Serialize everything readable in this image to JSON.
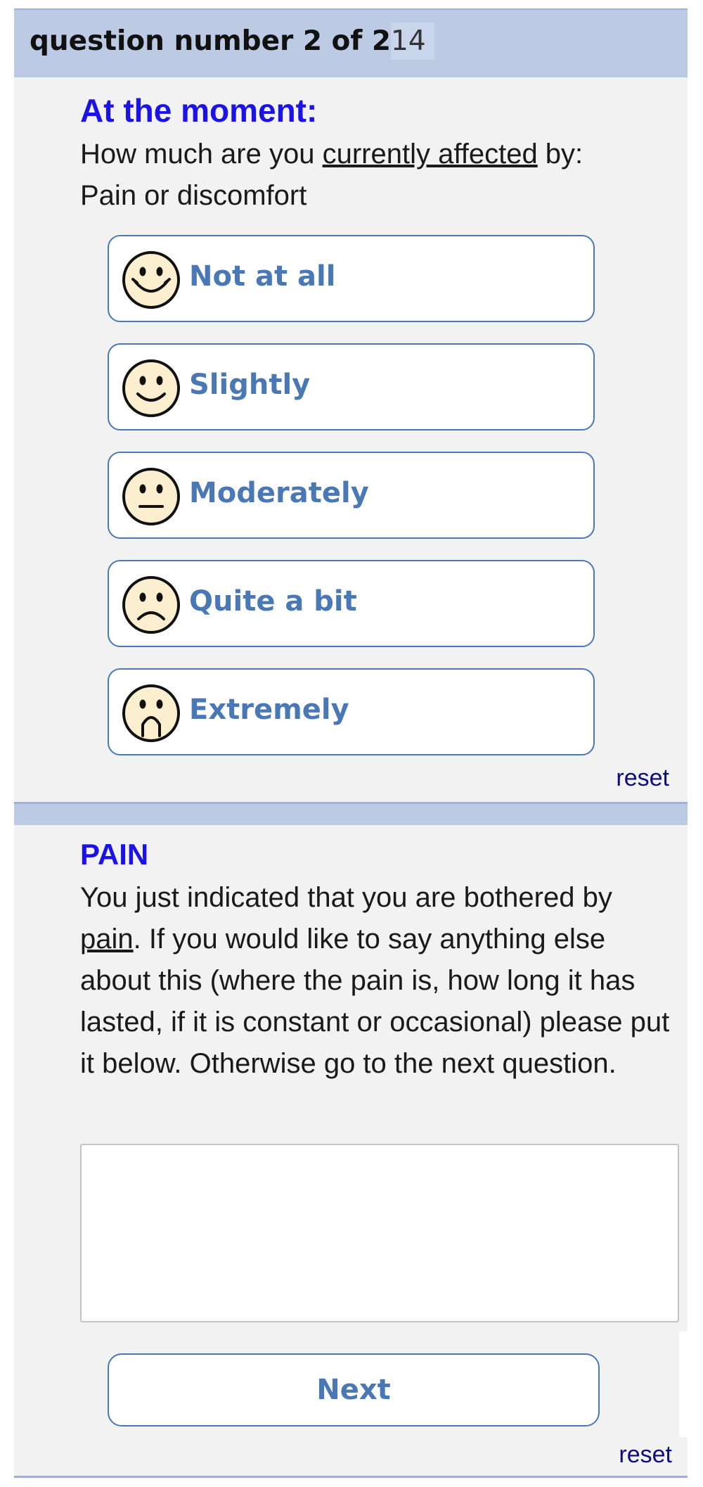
{
  "header": {
    "title": "question number 2 of 2",
    "count": "14"
  },
  "question": {
    "heading": "At the moment:",
    "prompt_prefix": "How much are you ",
    "prompt_underlined": "currently affected",
    "prompt_suffix": " by:",
    "topic": "Pain or discomfort",
    "options": [
      {
        "label": "Not at all",
        "icon": "very-happy-face-icon"
      },
      {
        "label": "Slightly",
        "icon": "happy-face-icon"
      },
      {
        "label": "Moderately",
        "icon": "neutral-face-icon"
      },
      {
        "label": "Quite a bit",
        "icon": "sad-face-icon"
      },
      {
        "label": "Extremely",
        "icon": "very-sad-face-icon"
      }
    ],
    "reset_label": "reset"
  },
  "followup": {
    "heading": "PAIN",
    "text_prefix": "You just indicated that you are bothered by ",
    "text_underlined": "pain",
    "text_suffix": ". If you would like to say anything else about this (where the pain is, how long it has lasted, if it is constant or occasional) please put it below. Otherwise go to the next question.",
    "comment_value": "",
    "next_label": "Next",
    "reset_label": "reset"
  },
  "colors": {
    "header_bg": "#bccbe3",
    "panel_bg": "#f2f2f2",
    "heading_blue": "#1a12e6",
    "option_blue": "#4a78b5",
    "face_fill": "#fbefcf"
  }
}
